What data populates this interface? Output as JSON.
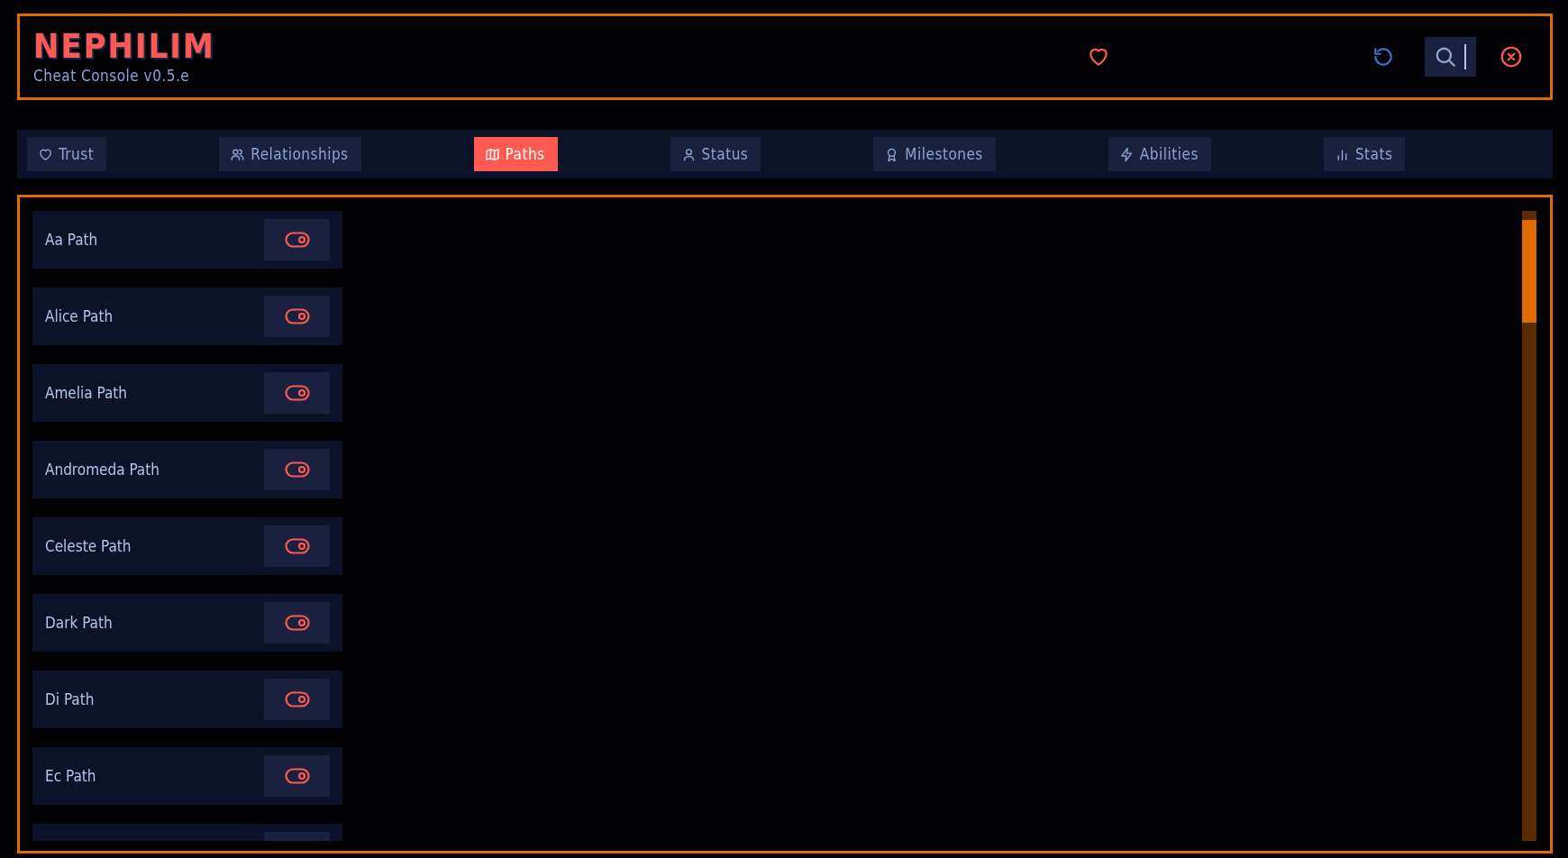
{
  "header": {
    "logo": "NEPHILIM",
    "subtitle": "Cheat Console v0.5.e"
  },
  "tabs": [
    {
      "label": "Trust",
      "selected": false
    },
    {
      "label": "Relationships",
      "selected": false
    },
    {
      "label": "Paths",
      "selected": true
    },
    {
      "label": "Status",
      "selected": false
    },
    {
      "label": "Milestones",
      "selected": false
    },
    {
      "label": "Abilities",
      "selected": false
    },
    {
      "label": "Stats",
      "selected": false
    }
  ],
  "paths": [
    {
      "kind": "full",
      "name": "Aa Path",
      "on": true
    },
    {
      "kind": "full",
      "name": "Alice Path",
      "on": true
    },
    {
      "kind": "full",
      "name": "Amelia Path",
      "on": true
    },
    {
      "kind": "full",
      "name": "Andromeda Path",
      "on": true
    },
    {
      "kind": "full",
      "name": "Celeste Path",
      "on": true
    },
    {
      "kind": "full",
      "name": "Dark Path",
      "on": true
    },
    {
      "kind": "full",
      "name": "Di Path",
      "on": true
    },
    {
      "kind": "full",
      "name": "Ec Path",
      "on": true
    },
    {
      "kind": "cut"
    }
  ]
}
